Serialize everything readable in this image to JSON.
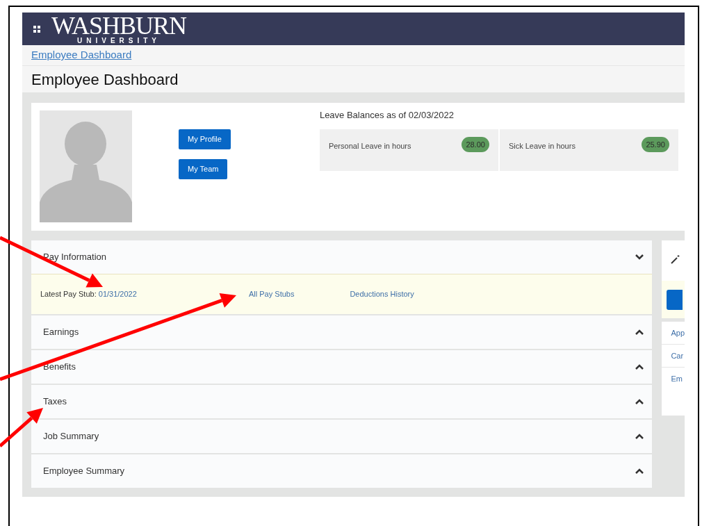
{
  "header": {
    "logo_title": "WASHBURN",
    "logo_subtitle": "UNIVERSITY"
  },
  "breadcrumb": "Employee Dashboard",
  "page_title": "Employee Dashboard",
  "profile_buttons": [
    "My Profile",
    "My Team"
  ],
  "leave_balances": {
    "title": "Leave Balances as of 02/03/2022",
    "items": [
      {
        "label": "Personal Leave in hours",
        "value": "28.00"
      },
      {
        "label": "Sick Leave in hours",
        "value": "25.90"
      }
    ]
  },
  "sections": [
    {
      "title": "Pay Information",
      "expanded": true,
      "latest_label": "Latest Pay Stub:",
      "latest_date": "01/31/2022",
      "links": [
        "All Pay Stubs",
        "Deductions History"
      ]
    },
    {
      "title": "Earnings",
      "expanded": false
    },
    {
      "title": "Benefits",
      "expanded": false
    },
    {
      "title": "Taxes",
      "expanded": false
    },
    {
      "title": "Job Summary",
      "expanded": false
    },
    {
      "title": "Employee Summary",
      "expanded": false
    }
  ],
  "side_links": [
    "App",
    "Car",
    "Em"
  ]
}
